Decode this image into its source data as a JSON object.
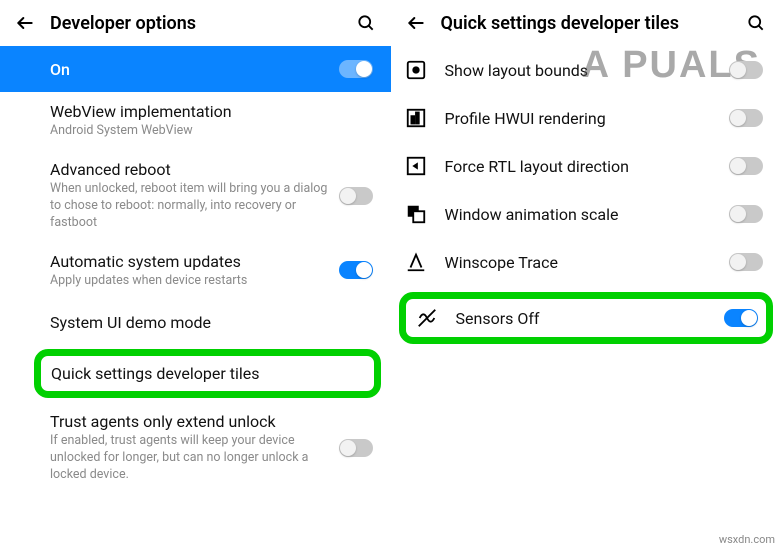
{
  "left": {
    "headerTitle": "Developer options",
    "rows": {
      "on": {
        "label": "On"
      },
      "webview": {
        "title": "WebView implementation",
        "sub": "Android System WebView"
      },
      "advreboot": {
        "title": "Advanced reboot",
        "sub": "When unlocked, reboot item will bring you a dialog to chose to reboot: normally, into recovery or fastboot"
      },
      "autosys": {
        "title": "Automatic system updates",
        "sub": "Apply updates when device restarts"
      },
      "demomode": {
        "title": "System UI demo mode"
      },
      "qstiles": {
        "title": "Quick settings developer tiles"
      },
      "trust": {
        "title": "Trust agents only extend unlock",
        "sub": "If enabled, trust agents will keep your device unlocked for longer, but can no longer unlock a locked device."
      }
    }
  },
  "right": {
    "headerTitle": "Quick settings developer tiles",
    "tiles": {
      "layout": "Show layout bounds",
      "hwui": "Profile HWUI rendering",
      "rtl": "Force RTL layout direction",
      "winanim": "Window animation scale",
      "winscope": "Winscope Trace",
      "sensors": "Sensors Off"
    }
  },
  "watermark": "A  PUALS",
  "source": "wsxdn.com"
}
